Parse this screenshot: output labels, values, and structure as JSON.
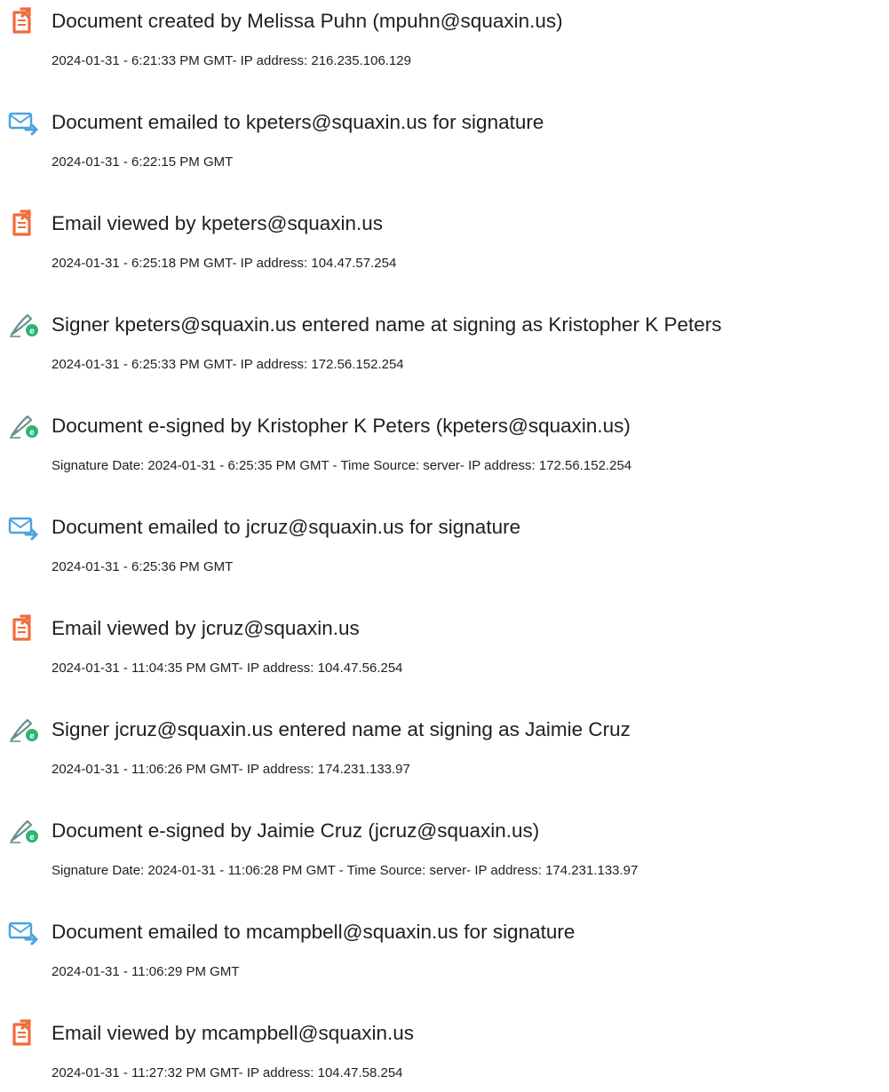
{
  "events": [
    {
      "icon": "document-created-icon",
      "title": "Document created by Melissa Puhn (mpuhn@squaxin.us)",
      "detail": "2024-01-31 - 6:21:33 PM GMT- IP address: 216.235.106.129"
    },
    {
      "icon": "email-sent-icon",
      "title": "Document emailed to kpeters@squaxin.us for signature",
      "detail": "2024-01-31 - 6:22:15 PM GMT"
    },
    {
      "icon": "document-viewed-icon",
      "title": "Email viewed by kpeters@squaxin.us",
      "detail": "2024-01-31 - 6:25:18 PM GMT- IP address: 104.47.57.254"
    },
    {
      "icon": "esign-pen-icon",
      "title": "Signer kpeters@squaxin.us entered name at signing as Kristopher K Peters",
      "detail": "2024-01-31 - 6:25:33 PM GMT- IP address: 172.56.152.254"
    },
    {
      "icon": "esign-pen-icon",
      "title": "Document e-signed by Kristopher K Peters (kpeters@squaxin.us)",
      "detail": "Signature Date: 2024-01-31 - 6:25:35 PM GMT - Time Source: server- IP address: 172.56.152.254"
    },
    {
      "icon": "email-sent-icon",
      "title": "Document emailed to jcruz@squaxin.us for signature",
      "detail": "2024-01-31 - 6:25:36 PM GMT"
    },
    {
      "icon": "document-viewed-icon",
      "title": "Email viewed by jcruz@squaxin.us",
      "detail": "2024-01-31 - 11:04:35 PM GMT- IP address: 104.47.56.254"
    },
    {
      "icon": "esign-pen-icon",
      "title": "Signer jcruz@squaxin.us entered name at signing as Jaimie Cruz",
      "detail": "2024-01-31 - 11:06:26 PM GMT- IP address: 174.231.133.97"
    },
    {
      "icon": "esign-pen-icon",
      "title": "Document e-signed by Jaimie Cruz (jcruz@squaxin.us)",
      "detail": "Signature Date: 2024-01-31 - 11:06:28 PM GMT - Time Source: server- IP address: 174.231.133.97"
    },
    {
      "icon": "email-sent-icon",
      "title": "Document emailed to mcampbell@squaxin.us for signature",
      "detail": "2024-01-31 - 11:06:29 PM GMT"
    },
    {
      "icon": "document-viewed-icon",
      "title": "Email viewed by mcampbell@squaxin.us",
      "detail": "2024-01-31 - 11:27:32 PM GMT- IP address: 104.47.58.254"
    }
  ],
  "colors": {
    "document_icon": "#f26b3a",
    "email_icon": "#4aa3df",
    "pen_icon": "#6b8e8e",
    "pen_badge": "#2bb673",
    "text": "#1f1f1f"
  }
}
